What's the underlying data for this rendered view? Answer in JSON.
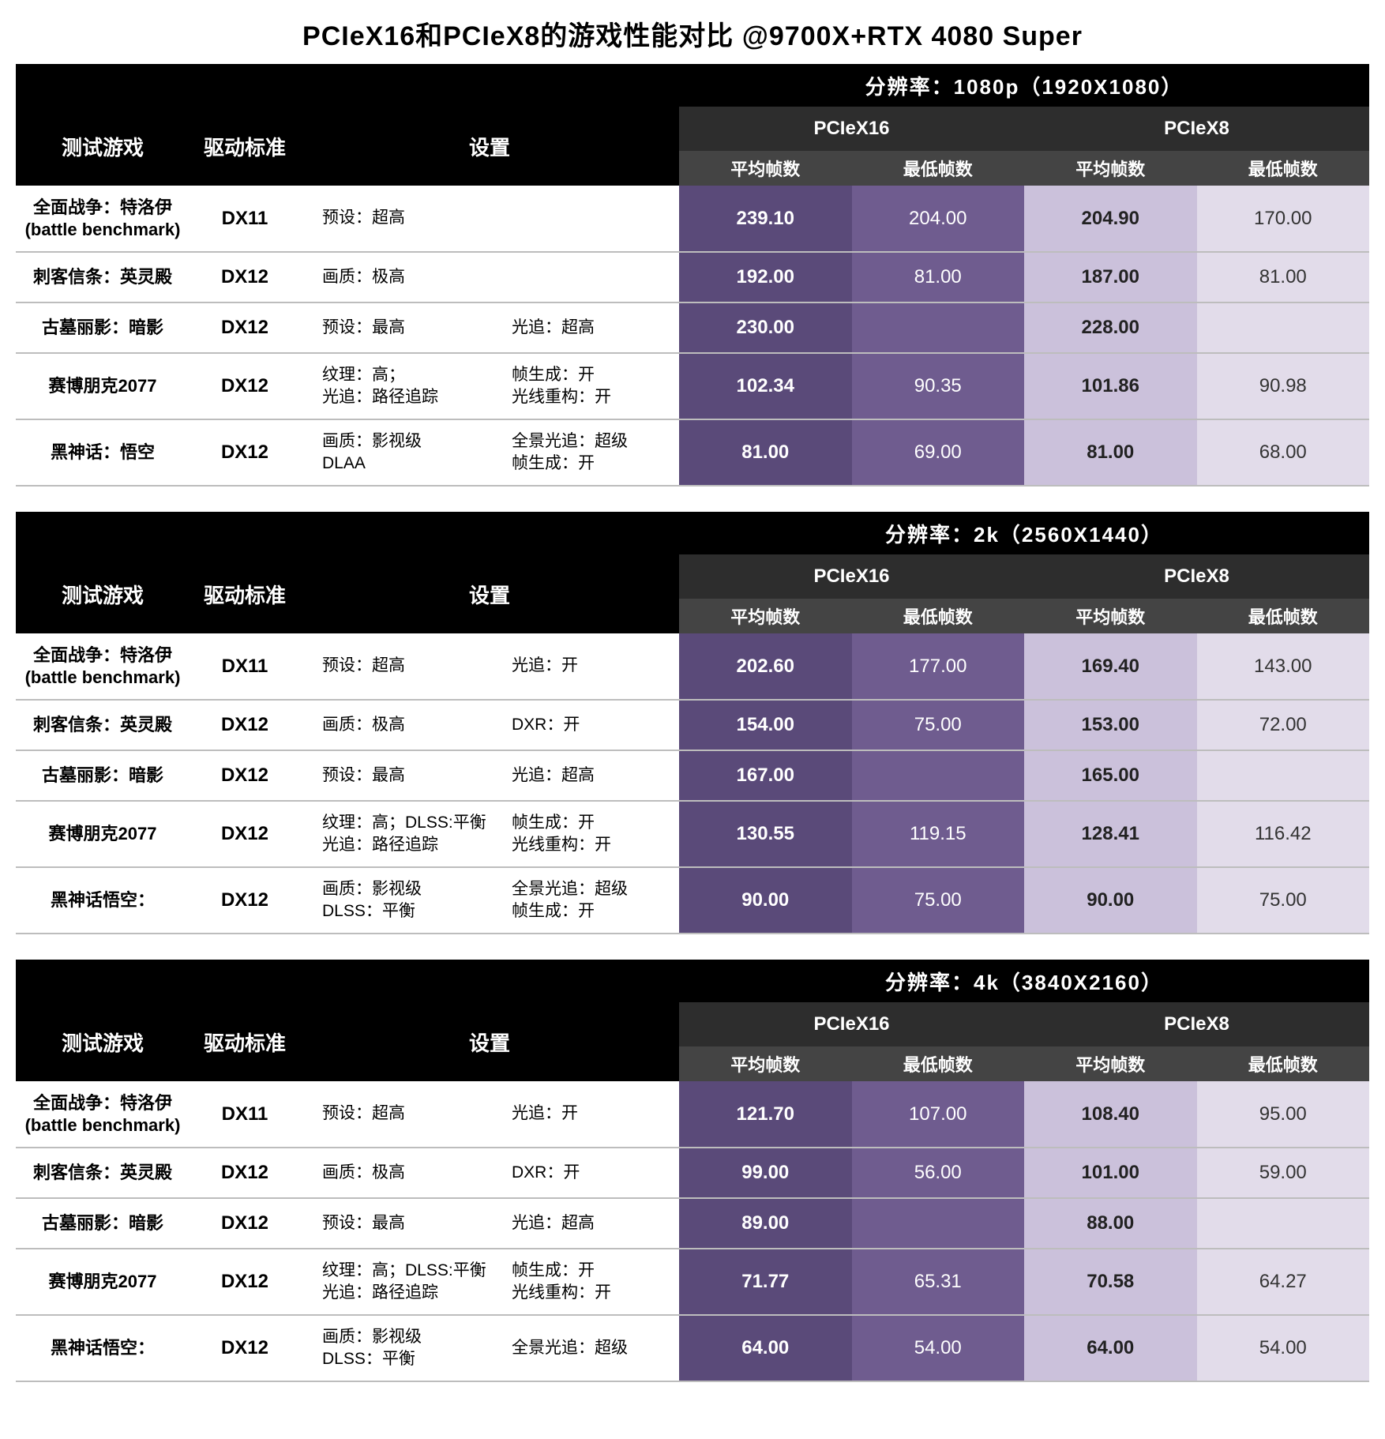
{
  "title": "PCIeX16和PCIeX8的游戏性能对比 @9700X+RTX 4080 Super",
  "headers": {
    "game": "测试游戏",
    "api": "驱动标准",
    "settings": "设置",
    "pcie16": "PCIeX16",
    "pcie8": "PCIeX8",
    "avg": "平均帧数",
    "low": "最低帧数",
    "res_prefix": "分辨率："
  },
  "sections": [
    {
      "resolution": "1080p（1920X1080）",
      "rows": [
        {
          "tall": true,
          "game": "全面战争：特洛伊\n(battle benchmark)",
          "api": "DX11",
          "set1": "预设：超高",
          "set2": "",
          "x16_avg": "239.10",
          "x16_low": "204.00",
          "x8_avg": "204.90",
          "x8_low": "170.00"
        },
        {
          "game": "刺客信条：英灵殿",
          "api": "DX12",
          "set1": "画质：极高",
          "set2": "",
          "x16_avg": "192.00",
          "x16_low": "81.00",
          "x8_avg": "187.00",
          "x8_low": "81.00"
        },
        {
          "game": "古墓丽影：暗影",
          "api": "DX12",
          "set1": "预设：最高",
          "set2": "光追：超高",
          "x16_avg": "230.00",
          "x16_low": "",
          "x8_avg": "228.00",
          "x8_low": ""
        },
        {
          "tall": true,
          "game": "赛博朋克2077",
          "api": "DX12",
          "set1": "纹理：高；\n光追：路径追踪",
          "set2": "帧生成：开\n光线重构：开",
          "x16_avg": "102.34",
          "x16_low": "90.35",
          "x8_avg": "101.86",
          "x8_low": "90.98"
        },
        {
          "tall": true,
          "game": "黑神话：悟空",
          "api": "DX12",
          "set1": "画质：影视级\nDLAA",
          "set2": "全景光追：超级\n帧生成：开",
          "x16_avg": "81.00",
          "x16_low": "69.00",
          "x8_avg": "81.00",
          "x8_low": "68.00"
        }
      ]
    },
    {
      "resolution": "2k（2560X1440）",
      "rows": [
        {
          "tall": true,
          "game": "全面战争：特洛伊\n(battle benchmark)",
          "api": "DX11",
          "set1": "预设：超高",
          "set2": "光追：开",
          "x16_avg": "202.60",
          "x16_low": "177.00",
          "x8_avg": "169.40",
          "x8_low": "143.00"
        },
        {
          "game": "刺客信条：英灵殿",
          "api": "DX12",
          "set1": "画质：极高",
          "set2": "DXR：开",
          "x16_avg": "154.00",
          "x16_low": "75.00",
          "x8_avg": "153.00",
          "x8_low": "72.00"
        },
        {
          "game": "古墓丽影：暗影",
          "api": "DX12",
          "set1": "预设：最高",
          "set2": "光追：超高",
          "x16_avg": "167.00",
          "x16_low": "",
          "x8_avg": "165.00",
          "x8_low": ""
        },
        {
          "tall": true,
          "game": "赛博朋克2077",
          "api": "DX12",
          "set1": "纹理：高；DLSS:平衡\n光追：路径追踪",
          "set2": "帧生成：开\n光线重构：开",
          "x16_avg": "130.55",
          "x16_low": "119.15",
          "x8_avg": "128.41",
          "x8_low": "116.42"
        },
        {
          "tall": true,
          "game": "黑神话悟空：",
          "api": "DX12",
          "set1": "画质：影视级\nDLSS：平衡",
          "set2": "全景光追：超级\n帧生成：开",
          "x16_avg": "90.00",
          "x16_low": "75.00",
          "x8_avg": "90.00",
          "x8_low": "75.00"
        }
      ]
    },
    {
      "resolution": "4k（3840X2160）",
      "rows": [
        {
          "tall": true,
          "game": "全面战争：特洛伊\n(battle benchmark)",
          "api": "DX11",
          "set1": "预设：超高",
          "set2": "光追：开",
          "x16_avg": "121.70",
          "x16_low": "107.00",
          "x8_avg": "108.40",
          "x8_low": "95.00"
        },
        {
          "game": "刺客信条：英灵殿",
          "api": "DX12",
          "set1": "画质：极高",
          "set2": "DXR：开",
          "x16_avg": "99.00",
          "x16_low": "56.00",
          "x8_avg": "101.00",
          "x8_low": "59.00"
        },
        {
          "game": "古墓丽影：暗影",
          "api": "DX12",
          "set1": "预设：最高",
          "set2": "光追：超高",
          "x16_avg": "89.00",
          "x16_low": "",
          "x8_avg": "88.00",
          "x8_low": ""
        },
        {
          "tall": true,
          "game": "赛博朋克2077",
          "api": "DX12",
          "set1": "纹理：高；DLSS:平衡\n光追：路径追踪",
          "set2": "帧生成：开\n光线重构：开",
          "x16_avg": "71.77",
          "x16_low": "65.31",
          "x8_avg": "70.58",
          "x8_low": "64.27"
        },
        {
          "tall": true,
          "game": "黑神话悟空：",
          "api": "DX12",
          "set1": "画质：影视级\nDLSS：平衡",
          "set2": "全景光追：超级",
          "x16_avg": "64.00",
          "x16_low": "54.00",
          "x8_avg": "64.00",
          "x8_low": "54.00"
        }
      ]
    }
  ],
  "chart_data": [
    {
      "type": "table",
      "title": "1080p (1920X1080)",
      "columns": [
        "game",
        "api",
        "settings",
        "PCIeX16_avg",
        "PCIeX16_low",
        "PCIeX8_avg",
        "PCIeX8_low"
      ],
      "rows": [
        [
          "全面战争：特洛伊 (battle benchmark)",
          "DX11",
          "预设：超高",
          239.1,
          204.0,
          204.9,
          170.0
        ],
        [
          "刺客信条：英灵殿",
          "DX12",
          "画质：极高",
          192.0,
          81.0,
          187.0,
          81.0
        ],
        [
          "古墓丽影：暗影",
          "DX12",
          "预设：最高 / 光追：超高",
          230.0,
          null,
          228.0,
          null
        ],
        [
          "赛博朋克2077",
          "DX12",
          "纹理：高；光追：路径追踪 / 帧生成：开 / 光线重构：开",
          102.34,
          90.35,
          101.86,
          90.98
        ],
        [
          "黑神话：悟空",
          "DX12",
          "画质：影视级 / DLAA / 全景光追：超级 / 帧生成：开",
          81.0,
          69.0,
          81.0,
          68.0
        ]
      ]
    },
    {
      "type": "table",
      "title": "2k (2560X1440)",
      "columns": [
        "game",
        "api",
        "settings",
        "PCIeX16_avg",
        "PCIeX16_low",
        "PCIeX8_avg",
        "PCIeX8_low"
      ],
      "rows": [
        [
          "全面战争：特洛伊 (battle benchmark)",
          "DX11",
          "预设：超高 / 光追：开",
          202.6,
          177.0,
          169.4,
          143.0
        ],
        [
          "刺客信条：英灵殿",
          "DX12",
          "画质：极高 / DXR：开",
          154.0,
          75.0,
          153.0,
          72.0
        ],
        [
          "古墓丽影：暗影",
          "DX12",
          "预设：最高 / 光追：超高",
          167.0,
          null,
          165.0,
          null
        ],
        [
          "赛博朋克2077",
          "DX12",
          "纹理：高；DLSS:平衡 / 光追：路径追踪 / 帧生成：开 / 光线重构：开",
          130.55,
          119.15,
          128.41,
          116.42
        ],
        [
          "黑神话悟空",
          "DX12",
          "画质：影视级 / DLSS：平衡 / 全景光追：超级 / 帧生成：开",
          90.0,
          75.0,
          90.0,
          75.0
        ]
      ]
    },
    {
      "type": "table",
      "title": "4k (3840X2160)",
      "columns": [
        "game",
        "api",
        "settings",
        "PCIeX16_avg",
        "PCIeX16_low",
        "PCIeX8_avg",
        "PCIeX8_low"
      ],
      "rows": [
        [
          "全面战争：特洛伊 (battle benchmark)",
          "DX11",
          "预设：超高 / 光追：开",
          121.7,
          107.0,
          108.4,
          95.0
        ],
        [
          "刺客信条：英灵殿",
          "DX12",
          "画质：极高 / DXR：开",
          99.0,
          56.0,
          101.0,
          59.0
        ],
        [
          "古墓丽影：暗影",
          "DX12",
          "预设：最高 / 光追：超高",
          89.0,
          null,
          88.0,
          null
        ],
        [
          "赛博朋克2077",
          "DX12",
          "纹理：高；DLSS:平衡 / 光追：路径追踪 / 帧生成：开 / 光线重构：开",
          71.77,
          65.31,
          70.58,
          64.27
        ],
        [
          "黑神话悟空",
          "DX12",
          "画质：影视级 / DLSS：平衡 / 全景光追：超级",
          64.0,
          54.0,
          64.0,
          54.0
        ]
      ]
    }
  ]
}
